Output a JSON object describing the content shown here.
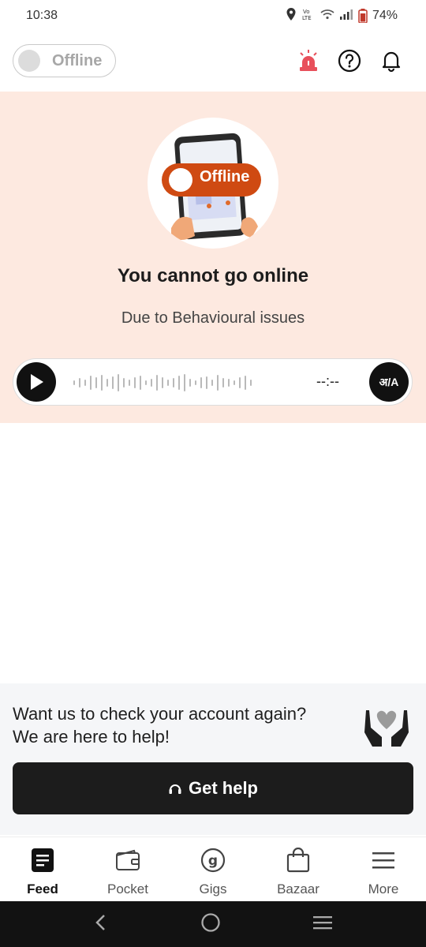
{
  "status_bar": {
    "time": "10:38",
    "network_label": "Vo))\nLTE",
    "battery": "74%",
    "icons": [
      "location-icon",
      "volte-icon",
      "wifi-icon",
      "signal-icon",
      "battery-icon"
    ]
  },
  "header": {
    "toggle_label": "Offline",
    "icons": [
      "siren-icon",
      "help-icon",
      "bell-icon"
    ]
  },
  "banner": {
    "illustration_label": "Offline",
    "title": "You cannot go online",
    "subtitle": "Due to Behavioural issues",
    "player": {
      "time": "--:--",
      "translate_label": "अ/A"
    }
  },
  "help_card": {
    "text": "Want us to check your account again? We are here to help!",
    "button_label": "Get help"
  },
  "bottom_nav": {
    "items": [
      {
        "label": "Feed",
        "icon": "feed-icon",
        "active": true
      },
      {
        "label": "Pocket",
        "icon": "wallet-icon",
        "active": false
      },
      {
        "label": "Gigs",
        "icon": "gigs-icon",
        "active": false
      },
      {
        "label": "Bazaar",
        "icon": "shopping-bag-icon",
        "active": false
      },
      {
        "label": "More",
        "icon": "menu-icon",
        "active": false
      }
    ]
  },
  "colors": {
    "banner_bg": "#fde9e0",
    "accent_orange": "#cf4a12",
    "siren_red": "#e8505b",
    "dark": "#1c1c1c"
  }
}
